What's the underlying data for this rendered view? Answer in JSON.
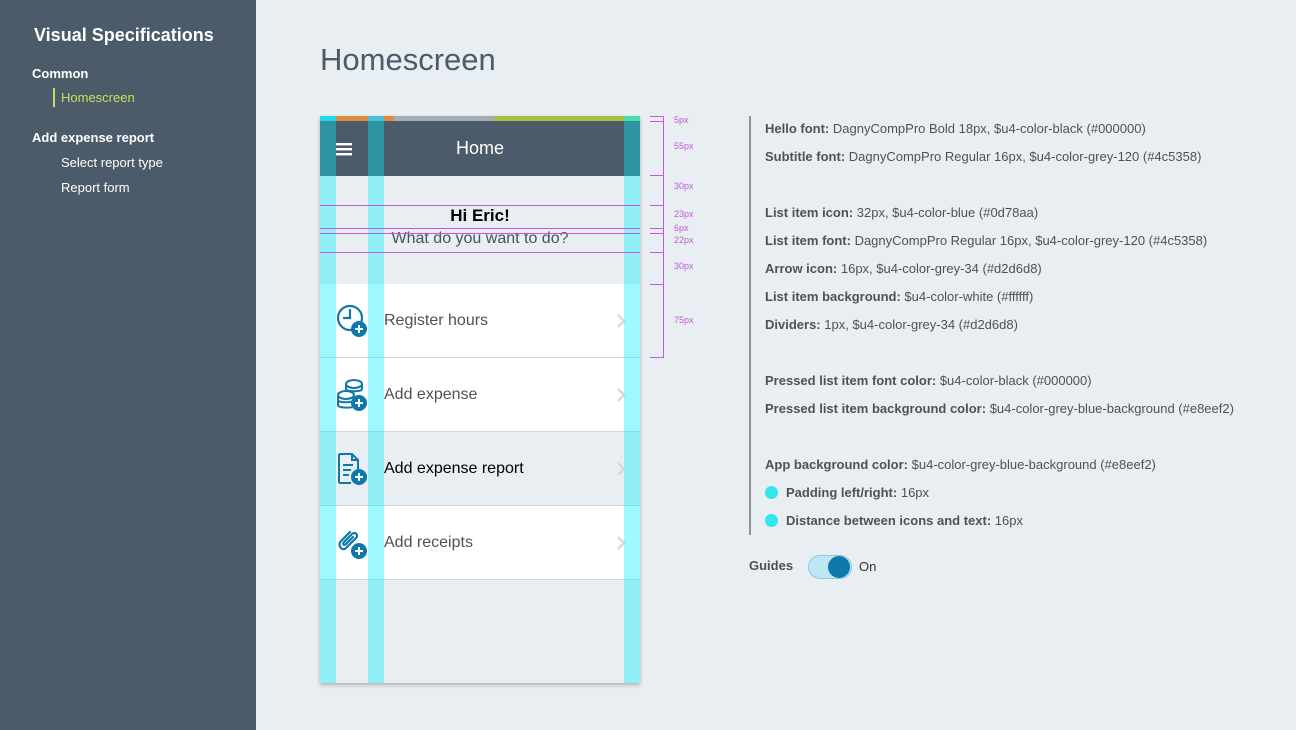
{
  "sidebar": {
    "title": "Visual Specifications",
    "sections": [
      {
        "label": "Common",
        "items": [
          "Homescreen"
        ]
      },
      {
        "label": "Add expense report",
        "items": [
          "Select report type",
          "Report form"
        ]
      }
    ],
    "active_item": "Homescreen"
  },
  "page": {
    "title": "Homescreen"
  },
  "phone": {
    "appbar_title": "Home",
    "greeting": "Hi Eric!",
    "subtitle": "What do you want to do?",
    "list_items": [
      {
        "label": "Register hours",
        "icon": "clock-add-icon",
        "pressed": false
      },
      {
        "label": "Add expense",
        "icon": "coins-add-icon",
        "pressed": false
      },
      {
        "label": "Add expense report",
        "icon": "document-add-icon",
        "pressed": true
      },
      {
        "label": "Add receipts",
        "icon": "paperclip-add-icon",
        "pressed": false
      }
    ]
  },
  "measurements": [
    "5px",
    "55px",
    "30px",
    "23px",
    "6px",
    "22px",
    "30px",
    "75px"
  ],
  "specs": [
    {
      "label": "Hello font:",
      "value": "DagnyCompPro Bold 18px, $u4-color-black (#000000)"
    },
    {
      "label": "Subtitle font:",
      "value": "DagnyCompPro Regular 16px, $u4-color-grey-120 (#4c5358)"
    },
    {
      "label": "List item icon:",
      "value": "32px, $u4-color-blue (#0d78aa)"
    },
    {
      "label": "List item font:",
      "value": "DagnyCompPro Regular 16px, $u4-color-grey-120 (#4c5358)"
    },
    {
      "label": "Arrow icon:",
      "value": "16px, $u4-color-grey-34 (#d2d6d8)"
    },
    {
      "label": "List item background:",
      "value": "$u4-color-white (#ffffff)"
    },
    {
      "label": "Dividers:",
      "value": "1px, $u4-color-grey-34 (#d2d6d8)"
    },
    {
      "label": "Pressed list item font color:",
      "value": "$u4-color-black (#000000)"
    },
    {
      "label": "Pressed list item background color:",
      "value": "$u4-color-grey-blue-background (#e8eef2)"
    },
    {
      "label": "App background color:",
      "value": "$u4-color-grey-blue-background (#e8eef2)"
    },
    {
      "label": "Padding left/right:",
      "value": "16px"
    },
    {
      "label": "Distance between icons and text:",
      "value": "16px"
    }
  ],
  "guides": {
    "label": "Guides",
    "state": "On",
    "enabled": true
  },
  "colors": {
    "sidebar_bg": "#4c5b69",
    "accent": "#c6e05c",
    "icon_blue": "#0d78aa",
    "guide_cyan": "#00f0ff",
    "measure_magenta": "#c35ad8",
    "app_bg": "#e8eef2"
  }
}
